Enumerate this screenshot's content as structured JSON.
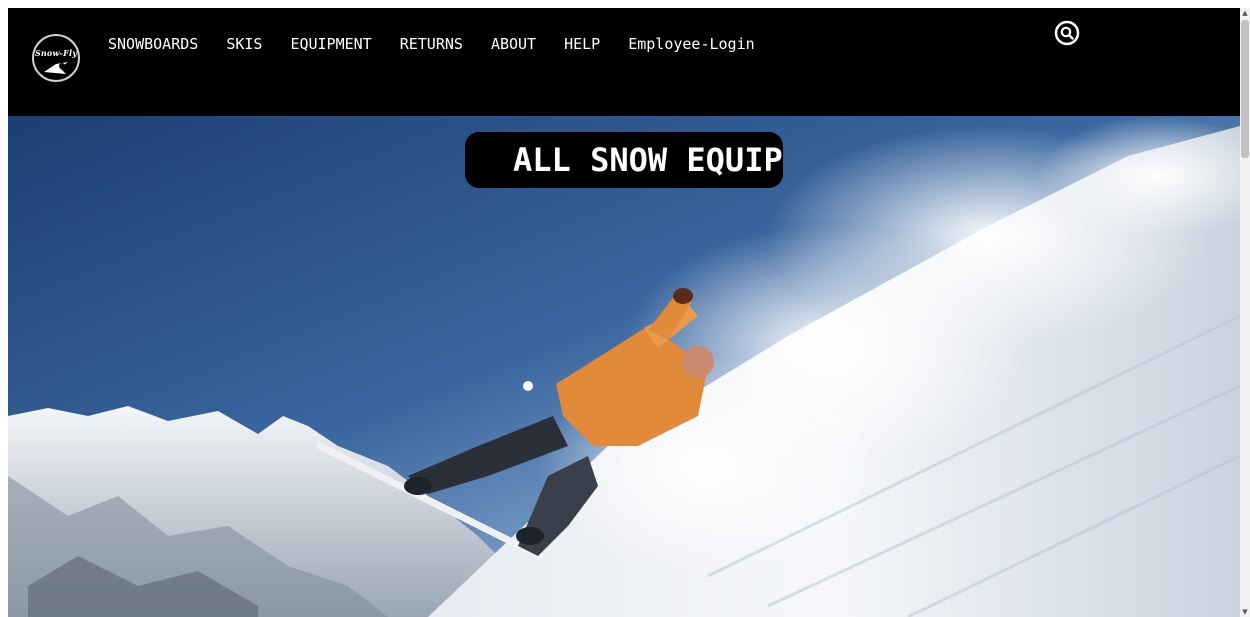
{
  "logo": {
    "text": "Snow-Fly"
  },
  "nav": {
    "links": [
      "SNOWBOARDS",
      "SKIS",
      "EQUIPMENT",
      "RETURNS",
      "ABOUT",
      "HELP",
      "Employee-Login"
    ]
  },
  "search": {
    "icon": "search-icon"
  },
  "hero": {
    "banner_text": "ALL SNOW EQUIPMENT",
    "image": "snowboarder-carving-powder"
  },
  "colors": {
    "navbar": "#000000",
    "nav_text": "#ffffff",
    "sky": "#3a67a0",
    "jacket": "#e08a3a"
  }
}
